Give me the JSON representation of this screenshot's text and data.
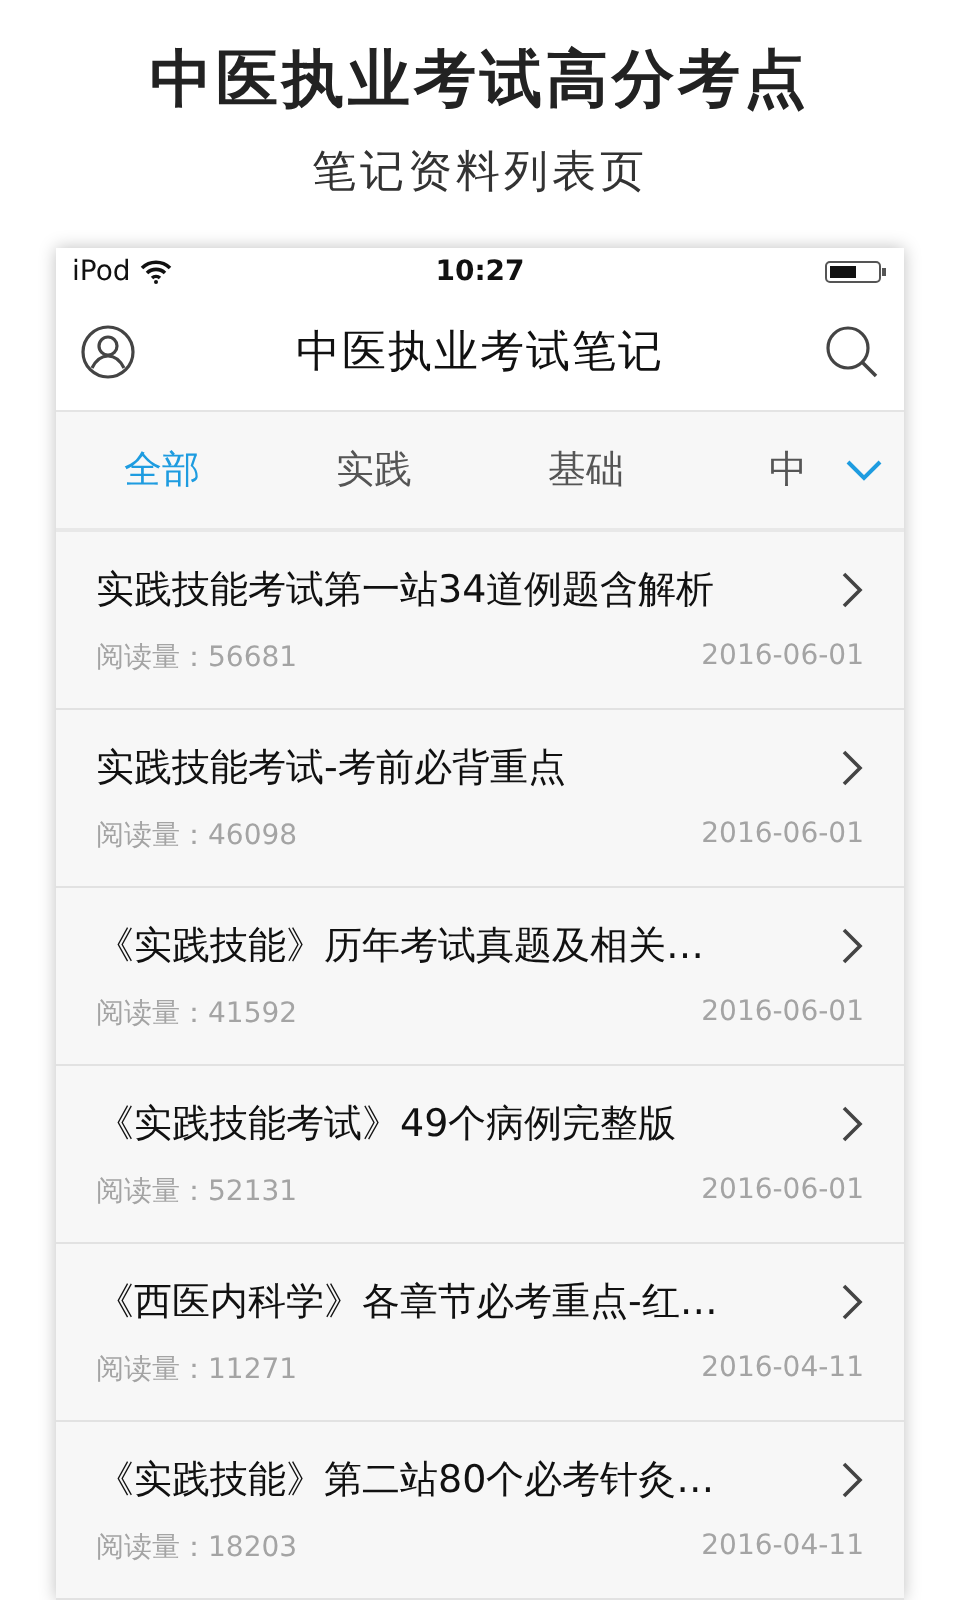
{
  "headline": "中医执业考试高分考点",
  "subtitle": "笔记资料列表页",
  "status_bar": {
    "carrier": "iPod",
    "time": "10:27"
  },
  "nav": {
    "title": "中医执业考试笔记"
  },
  "tabs": [
    {
      "label": "全部",
      "selected": true
    },
    {
      "label": "实践",
      "selected": false
    },
    {
      "label": "基础",
      "selected": false
    },
    {
      "label": "中",
      "selected": false
    }
  ],
  "notes": [
    {
      "title": "实践技能考试第一站34道例题含解析",
      "reads_label": "阅读量：",
      "reads": "56681",
      "date": "2016-06-01"
    },
    {
      "title": "实践技能考试-考前必背重点",
      "reads_label": "阅读量：",
      "reads": "46098",
      "date": "2016-06-01"
    },
    {
      "title": "《实践技能》历年考试真题及相关…",
      "reads_label": "阅读量：",
      "reads": "41592",
      "date": "2016-06-01"
    },
    {
      "title": "《实践技能考试》49个病例完整版",
      "reads_label": "阅读量：",
      "reads": "52131",
      "date": "2016-06-01"
    },
    {
      "title": "《西医内科学》各章节必考重点-红…",
      "reads_label": "阅读量：",
      "reads": "11271",
      "date": "2016-04-11"
    },
    {
      "title": "《实践技能》第二站80个必考针灸…",
      "reads_label": "阅读量：",
      "reads": "18203",
      "date": "2016-04-11"
    }
  ]
}
